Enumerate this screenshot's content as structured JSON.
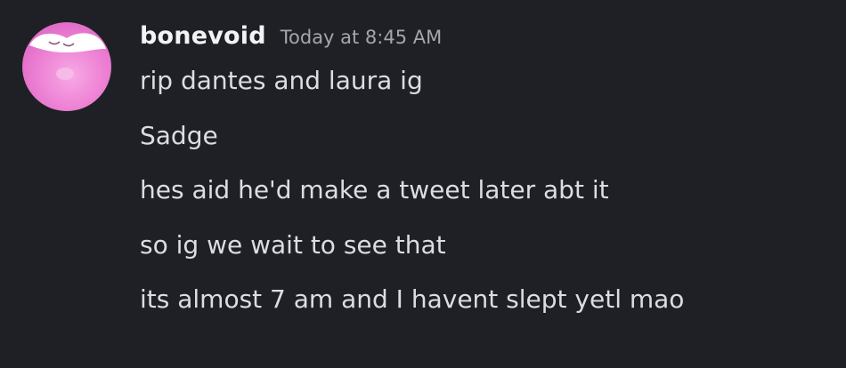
{
  "message": {
    "author": "bonevoid",
    "timestamp": "Today at 8:45 AM",
    "lines": [
      "rip dantes and laura ig",
      "Sadge",
      "hes aid he'd make a tweet later abt it",
      "so ig we wait to see that",
      "its almost 7 am and I havent slept yetl mao"
    ]
  },
  "colors": {
    "background": "#1f2025",
    "username": "#f2f3f5",
    "timestamp": "#a3a6ad",
    "text": "#dcdde1",
    "avatar": "#ef86d6"
  }
}
